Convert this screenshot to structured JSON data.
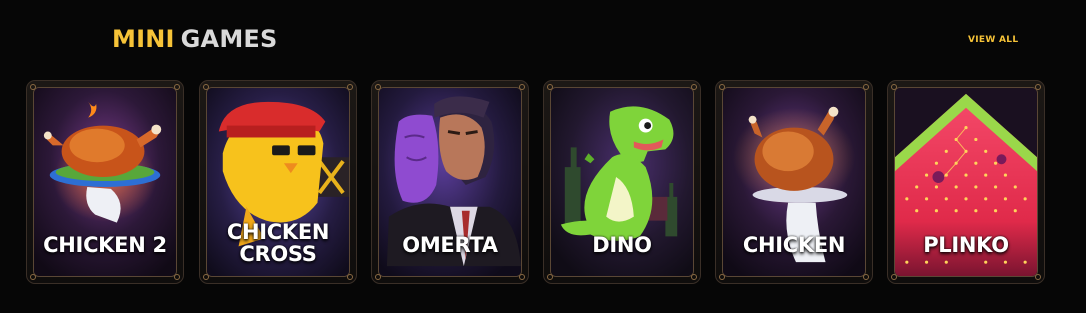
{
  "header": {
    "title_part1": "MINI",
    "title_part2": "GAMES",
    "view_all_label": "VIEW ALL"
  },
  "games": [
    {
      "name": "CHICKEN 2",
      "line1": "CHICKEN 2",
      "line2": "",
      "icon": "roast-chicken-platter-icon",
      "accent": "#e0572a"
    },
    {
      "name": "CHICKEN CROSS",
      "line1": "CHICKEN",
      "line2": "CROSS",
      "icon": "yellow-chick-red-cap-icon",
      "accent": "#f7c21c"
    },
    {
      "name": "OMERTA",
      "line1": "OMERTA",
      "line2": "",
      "icon": "mobster-with-mask-icon",
      "accent": "#8b3fd0"
    },
    {
      "name": "DINO",
      "line1": "DINO",
      "line2": "",
      "icon": "green-dinosaur-icon",
      "accent": "#7fd43a"
    },
    {
      "name": "CHICKEN",
      "line1": "CHICKEN",
      "line2": "",
      "icon": "roast-chicken-tray-icon",
      "accent": "#e8803a"
    },
    {
      "name": "PLINKO",
      "line1": "PLINKO",
      "line2": "",
      "icon": "plinko-board-icon",
      "accent": "#f03a55"
    }
  ],
  "colors": {
    "background": "#060606",
    "title_accent": "#f6c338",
    "title_secondary": "#d9d9d9",
    "card_border": "#5a4735"
  }
}
